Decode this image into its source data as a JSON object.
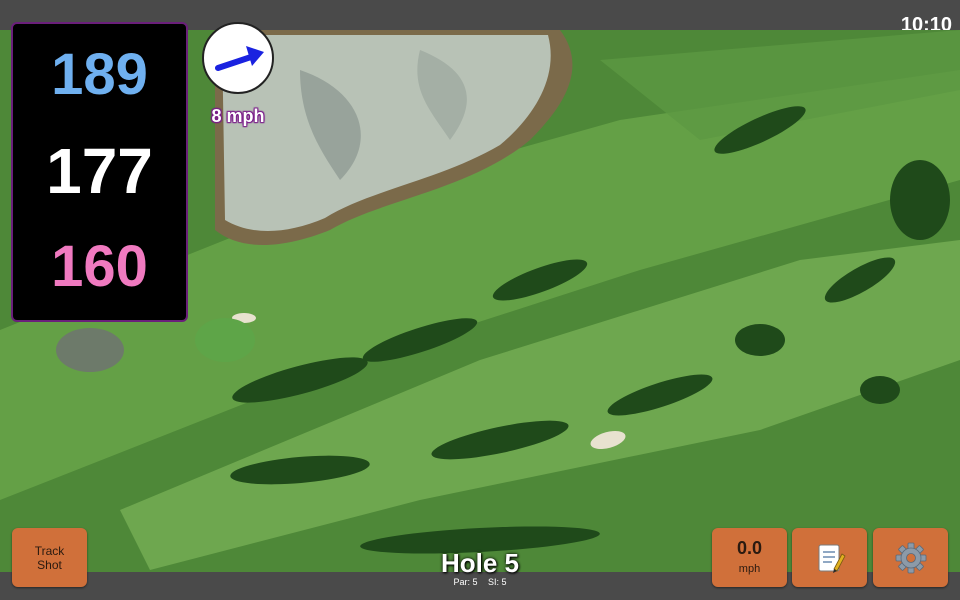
{
  "status_bar": {
    "time": "10:10"
  },
  "distances": {
    "back": "189",
    "middle": "177",
    "front": "160"
  },
  "wind": {
    "speed_label": "8 mph",
    "direction_icon": "arrow-icon"
  },
  "hole": {
    "title": "Hole 5",
    "par": "Par: 5",
    "stroke_index": "SI: 5"
  },
  "buttons": {
    "track_shot_line1": "Track",
    "track_shot_line2": "Shot",
    "speed_value": "0.0",
    "speed_unit": "mph",
    "notes_icon": "notepad-icon",
    "settings_icon": "gear-icon"
  },
  "colors": {
    "back_distance": "#6fb0f0",
    "middle_distance": "#ffffff",
    "front_distance": "#f07ac0",
    "button": "#d0703a",
    "wind_arrow": "#1a22e0"
  }
}
